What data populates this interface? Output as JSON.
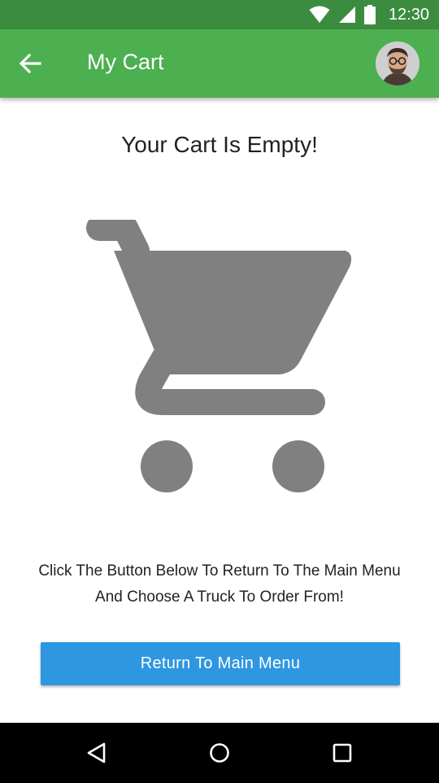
{
  "status_bar": {
    "time": "12:30",
    "icons": [
      "wifi-icon",
      "cellular-signal-icon",
      "battery-icon"
    ]
  },
  "app_bar": {
    "title": "My Cart",
    "back_icon": "arrow-back-icon",
    "avatar": "user-avatar",
    "background_color": "#4caf50"
  },
  "main": {
    "empty_title": "Your Cart Is Empty!",
    "illustration_icon": "shopping-cart-icon",
    "instructions": [
      "Click The Button Below To Return To The Main Menu",
      "And Choose A Truck To Order From!"
    ],
    "return_button_label": "Return To Main Menu",
    "button_color": "#2f96e1"
  },
  "nav_bar": {
    "icons": [
      "back-triangle-icon",
      "home-circle-icon",
      "recents-square-icon"
    ]
  }
}
